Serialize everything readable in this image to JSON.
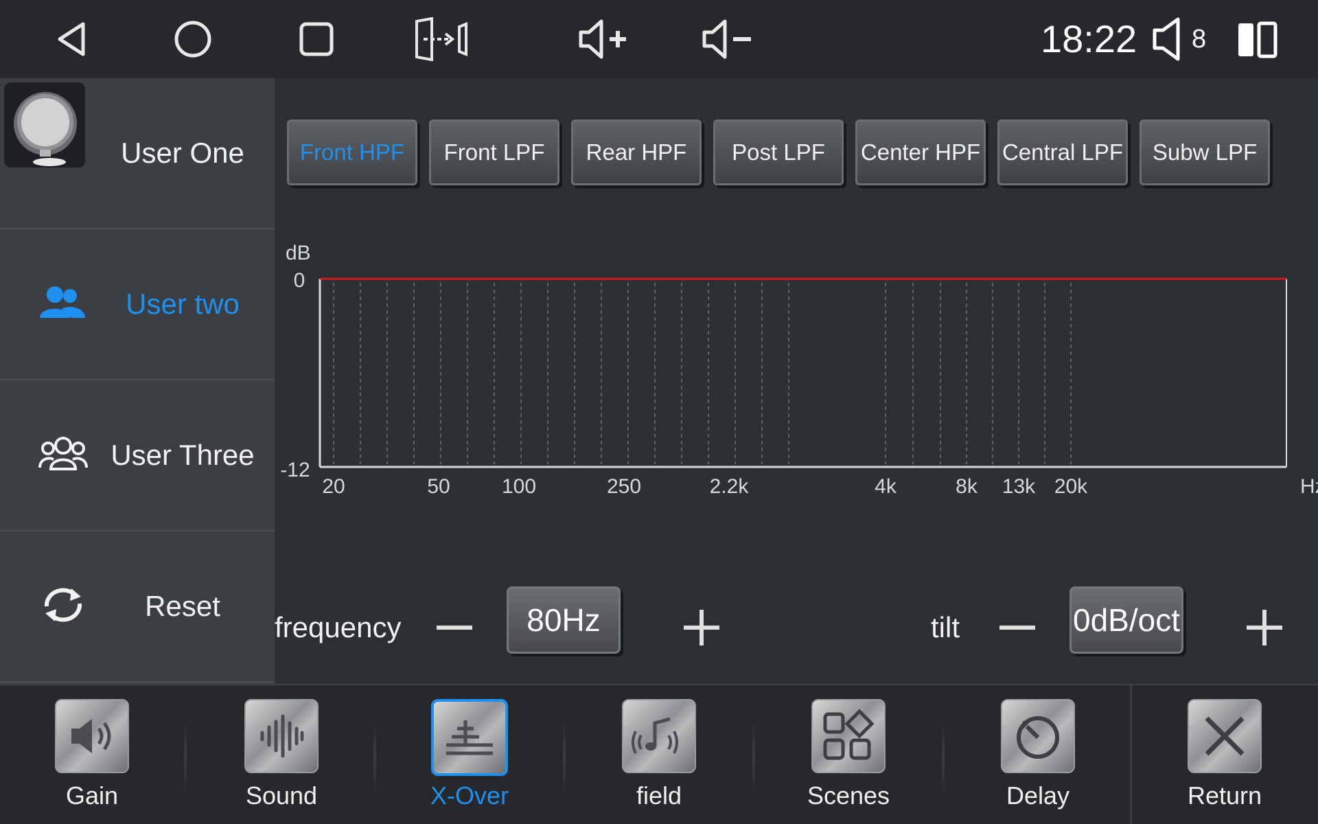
{
  "status_bar": {
    "time": "18:22",
    "volume_level": "8",
    "icons": [
      "back-icon",
      "home-icon",
      "recents-icon",
      "screen-mirror-icon",
      "volume-up-icon",
      "volume-down-icon",
      "speaker-icon",
      "split-screen-icon"
    ]
  },
  "sidebar": {
    "items": [
      {
        "label": "User One",
        "icon": "avatar-icon",
        "active": false
      },
      {
        "label": "User two",
        "icon": "users-icon",
        "active": true
      },
      {
        "label": "User Three",
        "icon": "group-icon",
        "active": false
      },
      {
        "label": "Reset",
        "icon": "refresh-icon",
        "active": false
      }
    ]
  },
  "tabs": [
    {
      "label": "Front HPF",
      "active": true
    },
    {
      "label": "Front LPF",
      "active": false
    },
    {
      "label": "Rear HPF",
      "active": false
    },
    {
      "label": "Post LPF",
      "active": false
    },
    {
      "label": "Center HPF",
      "active": false
    },
    {
      "label": "Central LPF",
      "active": false
    },
    {
      "label": "Subw LPF",
      "active": false
    }
  ],
  "chart_data": {
    "type": "line",
    "ylabel": "dB",
    "y_ticks": [
      "0",
      "-12"
    ],
    "ylim": [
      -12,
      0
    ],
    "x_ticks": [
      "20",
      "50",
      "100",
      "250",
      "2.2k",
      "4k",
      "8k",
      "13k",
      "20k"
    ],
    "xunit": "Hz",
    "series": [
      {
        "values": [
          0,
          0,
          0,
          0,
          0,
          0,
          0,
          0,
          0
        ]
      }
    ],
    "grid": true,
    "line_color": "#d01c1c"
  },
  "controls": {
    "frequency_label": "frequency",
    "frequency_value": "80Hz",
    "tilt_label": "tilt",
    "tilt_value": "0dB/oct"
  },
  "bottom_nav": [
    {
      "label": "Gain",
      "icon": "speaker-gain-icon",
      "active": false
    },
    {
      "label": "Sound",
      "icon": "sound-wave-icon",
      "active": false
    },
    {
      "label": "X-Over",
      "icon": "crossover-icon",
      "active": true
    },
    {
      "label": "field",
      "icon": "sound-field-icon",
      "active": false
    },
    {
      "label": "Scenes",
      "icon": "scenes-icon",
      "active": false
    },
    {
      "label": "Delay",
      "icon": "delay-icon",
      "active": false
    },
    {
      "label": "Return",
      "icon": "close-icon",
      "active": false
    }
  ],
  "colors": {
    "accent": "#1e90f0",
    "curve": "#d01c1c",
    "background": "#2c2f33"
  }
}
